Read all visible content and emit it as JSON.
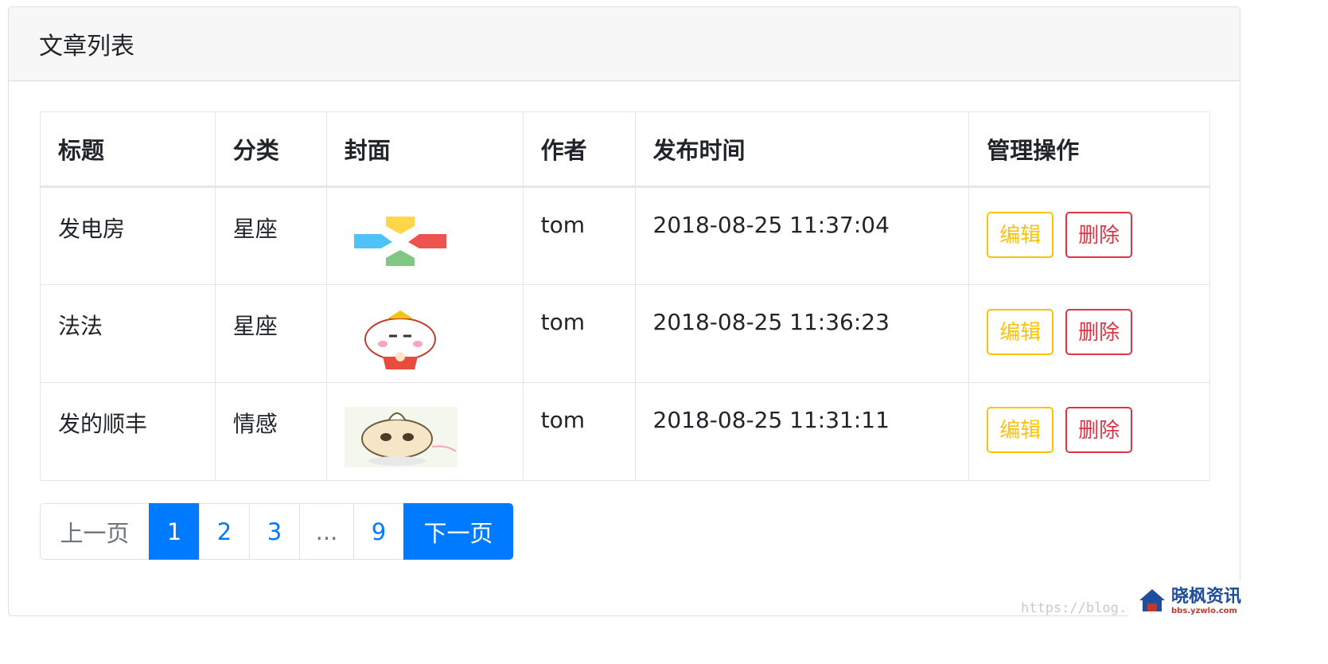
{
  "card": {
    "title": "文章列表"
  },
  "table": {
    "headers": [
      "标题",
      "分类",
      "封面",
      "作者",
      "发布时间",
      "管理操作"
    ],
    "rows": [
      {
        "title": "发电房",
        "category": "星座",
        "cover": "colorful-cross-logo",
        "author": "tom",
        "time": "2018-08-25 11:37:04"
      },
      {
        "title": "法法",
        "category": "星座",
        "cover": "lucky-cat-greeting",
        "author": "tom",
        "time": "2018-08-25 11:36:23"
      },
      {
        "title": "发的顺丰",
        "category": "情感",
        "cover": "cat-with-dumpling-hat",
        "author": "tom",
        "time": "2018-08-25 11:31:11"
      }
    ],
    "edit_label": "编辑",
    "delete_label": "删除"
  },
  "pagination": {
    "prev": "上一页",
    "pages": [
      "1",
      "2",
      "3"
    ],
    "ellipsis": "...",
    "last": "9",
    "next": "下一页",
    "active": "1"
  },
  "watermark": {
    "url": "https://blog.c",
    "logo_main": "晓枫资讯",
    "logo_sub": "bbs.yzwlo.com"
  },
  "colors": {
    "primary": "#007bff",
    "warning": "#ffc107",
    "danger": "#dc3545"
  }
}
